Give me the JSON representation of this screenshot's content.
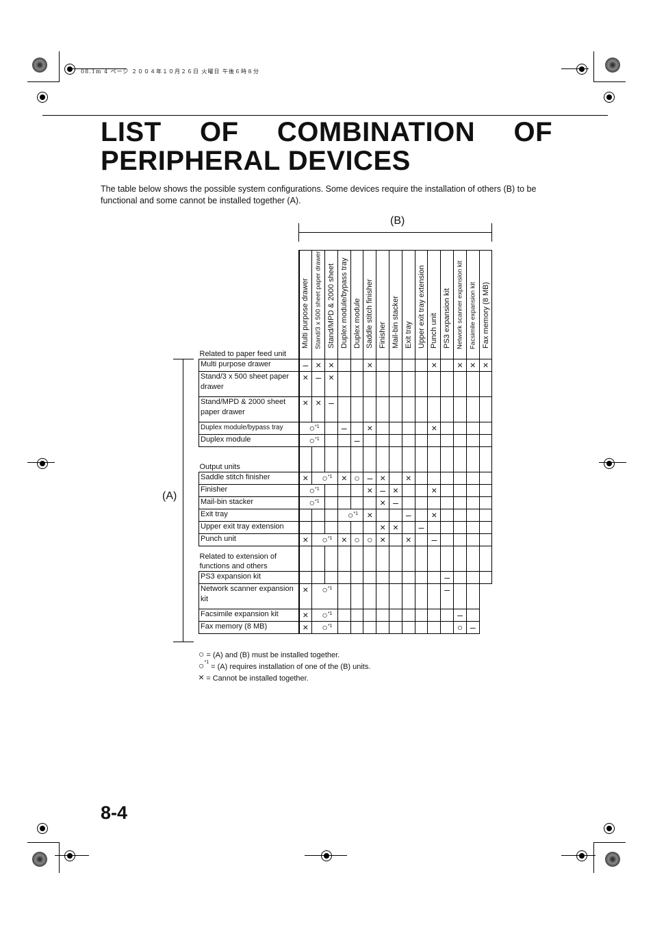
{
  "print_header": "08.1m  4 ページ  ２００４年１０月２６日  火曜日  午後６時８分",
  "title_line1": "LIST OF COMBINATION OF",
  "title_line2": "PERIPHERAL DEVICES",
  "intro": "The table below shows the possible system configurations. Some devices require the installation of others (B) to be functional and some cannot be installed together (A).",
  "label_b": "(B)",
  "label_a": "(A)",
  "columns": [
    "Multi purpose drawer",
    "Stand/3 x 500 sheet paper drawer",
    "Stand/MPD & 2000 sheet",
    "Duplex module/bypass tray",
    "Duplex module",
    "Saddle stitch finisher",
    "Finisher",
    "Mail-bin stacker",
    "Exit tray",
    "Upper exit tray extension",
    "Punch unit",
    "PS3 expansion kit",
    "Network scanner expansion kit",
    "Facsimile expansion kit",
    "Fax memory (8 MB)"
  ],
  "rows": [
    {
      "section": "Related to paper feed unit",
      "header": true
    },
    {
      "label": "Multi purpose drawer",
      "cells": [
        "–",
        "×",
        "×",
        "",
        "",
        "×",
        "",
        "",
        "",
        "",
        "×",
        "",
        "×",
        "×",
        "×"
      ]
    },
    {
      "label": "Stand/3 x 500 sheet paper drawer",
      "tall": true,
      "cells": [
        "×",
        "–",
        "×",
        "",
        "",
        "",
        "",
        "",
        "",
        "",
        "",
        "",
        "",
        "",
        ""
      ]
    },
    {
      "label": "Stand/MPD & 2000 sheet paper drawer",
      "tall": true,
      "cells": [
        "×",
        "×",
        "–",
        "",
        "",
        "",
        "",
        "",
        "",
        "",
        "",
        "",
        "",
        "",
        ""
      ]
    },
    {
      "label": "Duplex module/bypass tray",
      "small": true,
      "cells": [
        {
          "v": "○",
          "sup": "*1",
          "span": 2
        },
        "",
        "–",
        "",
        "×",
        "",
        "",
        "",
        "",
        "×",
        "",
        "",
        "",
        ""
      ]
    },
    {
      "label": "Duplex module",
      "cells": [
        {
          "v": "○",
          "sup": "*1",
          "span": 2
        },
        "",
        "",
        "–",
        "",
        "",
        "",
        "",
        "",
        "",
        "",
        "",
        "",
        ""
      ]
    },
    {
      "section": "Output units"
    },
    {
      "label": "Saddle stitch finisher",
      "cells": [
        "×",
        {
          "v": "○",
          "sup": "*1",
          "span": 2
        },
        "×",
        "○",
        "–",
        "×",
        "",
        "×",
        "",
        "",
        "",
        "",
        "",
        ""
      ]
    },
    {
      "label": "Finisher",
      "cells": [
        {
          "v": "○",
          "sup": "*1",
          "span": 2
        },
        "",
        "",
        "",
        "×",
        "–",
        "×",
        "",
        "",
        "×",
        "",
        "",
        "",
        ""
      ]
    },
    {
      "label": "Mail-bin stacker",
      "cells": [
        {
          "v": "○",
          "sup": "*1",
          "span": 2
        },
        "",
        "",
        "",
        "",
        "×",
        "–",
        "",
        "",
        "",
        "",
        "",
        "",
        ""
      ]
    },
    {
      "label": "Exit tray",
      "cells": [
        "",
        "",
        "",
        {
          "v": "○",
          "sup": "*1",
          "span": 2
        },
        "×",
        "",
        "",
        "–",
        "",
        "×",
        "",
        "",
        "",
        ""
      ]
    },
    {
      "label": "Upper exit tray extension",
      "cells": [
        "",
        "",
        "",
        "",
        "",
        "",
        "×",
        "×",
        "",
        "–",
        "",
        "",
        "",
        "",
        ""
      ]
    },
    {
      "label": "Punch unit",
      "cells": [
        "×",
        {
          "v": "○",
          "sup": "*1",
          "span": 2
        },
        "×",
        "○",
        "○",
        "×",
        "",
        "×",
        "",
        "–",
        "",
        "",
        "",
        ""
      ]
    },
    {
      "section": "Related to extension of functions and others"
    },
    {
      "label": "PS3 expansion kit",
      "cells": [
        "",
        "",
        "",
        "",
        "",
        "",
        "",
        "",
        "",
        "",
        "",
        "–",
        "",
        "",
        ""
      ]
    },
    {
      "label": "Network scanner expansion kit",
      "tall": true,
      "cells": [
        "×",
        {
          "v": "○",
          "sup": "*1",
          "span": 2
        },
        "",
        "",
        "",
        "",
        "",
        "",
        "",
        "",
        "–",
        "",
        ""
      ]
    },
    {
      "label": "Facsimile expansion kit",
      "cells": [
        "×",
        {
          "v": "○",
          "sup": "*1",
          "span": 2
        },
        "",
        "",
        "",
        "",
        "",
        "",
        "",
        "",
        "",
        "–",
        ""
      ]
    },
    {
      "label": "Fax memory (8 MB)",
      "cells": [
        "×",
        {
          "v": "○",
          "sup": "*1",
          "span": 2
        },
        "",
        "",
        "",
        "",
        "",
        "",
        "",
        "",
        "",
        "○",
        "–"
      ]
    }
  ],
  "legend": [
    {
      "symbol": "○",
      "sup": "",
      "text": "= (A) and (B) must be installed together."
    },
    {
      "symbol": "○",
      "sup": "*1",
      "text": "= (A) requires installation of one of the (B) units."
    },
    {
      "symbol": "×",
      "sup": "",
      "text": "= Cannot be installed together."
    }
  ],
  "page_number": "8-4"
}
